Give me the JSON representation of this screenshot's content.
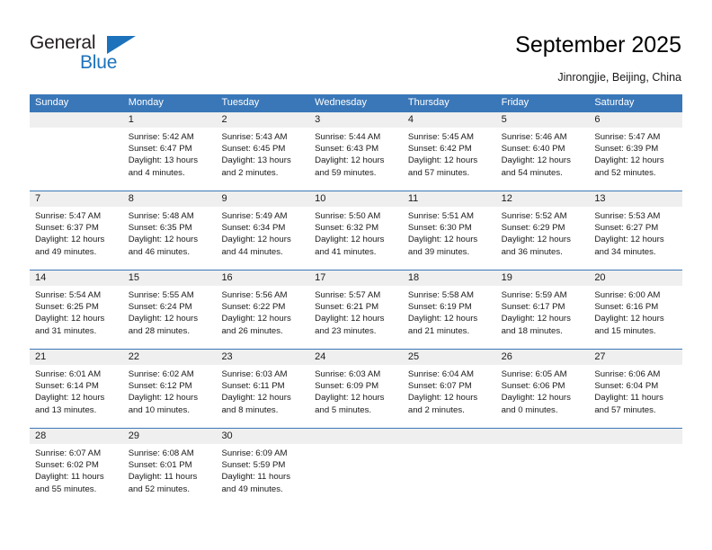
{
  "brand": {
    "name_top": "General",
    "name_bottom": "Blue",
    "triangle_icon": "triangle-icon",
    "accent_color": "#1c72bb"
  },
  "header": {
    "title": "September 2025",
    "location": "Jinrongjie, Beijing, China"
  },
  "theme": {
    "header_blue": "#3a77b8",
    "daynum_gray": "#efefef",
    "text": "#1a1a1a"
  },
  "weekdays": [
    "Sunday",
    "Monday",
    "Tuesday",
    "Wednesday",
    "Thursday",
    "Friday",
    "Saturday"
  ],
  "weeks": [
    {
      "days": [
        {
          "num": "",
          "sunrise": "",
          "sunset": "",
          "daylight_1": "",
          "daylight_2": ""
        },
        {
          "num": "1",
          "sunrise": "Sunrise: 5:42 AM",
          "sunset": "Sunset: 6:47 PM",
          "daylight_1": "Daylight: 13 hours",
          "daylight_2": "and 4 minutes."
        },
        {
          "num": "2",
          "sunrise": "Sunrise: 5:43 AM",
          "sunset": "Sunset: 6:45 PM",
          "daylight_1": "Daylight: 13 hours",
          "daylight_2": "and 2 minutes."
        },
        {
          "num": "3",
          "sunrise": "Sunrise: 5:44 AM",
          "sunset": "Sunset: 6:43 PM",
          "daylight_1": "Daylight: 12 hours",
          "daylight_2": "and 59 minutes."
        },
        {
          "num": "4",
          "sunrise": "Sunrise: 5:45 AM",
          "sunset": "Sunset: 6:42 PM",
          "daylight_1": "Daylight: 12 hours",
          "daylight_2": "and 57 minutes."
        },
        {
          "num": "5",
          "sunrise": "Sunrise: 5:46 AM",
          "sunset": "Sunset: 6:40 PM",
          "daylight_1": "Daylight: 12 hours",
          "daylight_2": "and 54 minutes."
        },
        {
          "num": "6",
          "sunrise": "Sunrise: 5:47 AM",
          "sunset": "Sunset: 6:39 PM",
          "daylight_1": "Daylight: 12 hours",
          "daylight_2": "and 52 minutes."
        }
      ]
    },
    {
      "days": [
        {
          "num": "7",
          "sunrise": "Sunrise: 5:47 AM",
          "sunset": "Sunset: 6:37 PM",
          "daylight_1": "Daylight: 12 hours",
          "daylight_2": "and 49 minutes."
        },
        {
          "num": "8",
          "sunrise": "Sunrise: 5:48 AM",
          "sunset": "Sunset: 6:35 PM",
          "daylight_1": "Daylight: 12 hours",
          "daylight_2": "and 46 minutes."
        },
        {
          "num": "9",
          "sunrise": "Sunrise: 5:49 AM",
          "sunset": "Sunset: 6:34 PM",
          "daylight_1": "Daylight: 12 hours",
          "daylight_2": "and 44 minutes."
        },
        {
          "num": "10",
          "sunrise": "Sunrise: 5:50 AM",
          "sunset": "Sunset: 6:32 PM",
          "daylight_1": "Daylight: 12 hours",
          "daylight_2": "and 41 minutes."
        },
        {
          "num": "11",
          "sunrise": "Sunrise: 5:51 AM",
          "sunset": "Sunset: 6:30 PM",
          "daylight_1": "Daylight: 12 hours",
          "daylight_2": "and 39 minutes."
        },
        {
          "num": "12",
          "sunrise": "Sunrise: 5:52 AM",
          "sunset": "Sunset: 6:29 PM",
          "daylight_1": "Daylight: 12 hours",
          "daylight_2": "and 36 minutes."
        },
        {
          "num": "13",
          "sunrise": "Sunrise: 5:53 AM",
          "sunset": "Sunset: 6:27 PM",
          "daylight_1": "Daylight: 12 hours",
          "daylight_2": "and 34 minutes."
        }
      ]
    },
    {
      "days": [
        {
          "num": "14",
          "sunrise": "Sunrise: 5:54 AM",
          "sunset": "Sunset: 6:25 PM",
          "daylight_1": "Daylight: 12 hours",
          "daylight_2": "and 31 minutes."
        },
        {
          "num": "15",
          "sunrise": "Sunrise: 5:55 AM",
          "sunset": "Sunset: 6:24 PM",
          "daylight_1": "Daylight: 12 hours",
          "daylight_2": "and 28 minutes."
        },
        {
          "num": "16",
          "sunrise": "Sunrise: 5:56 AM",
          "sunset": "Sunset: 6:22 PM",
          "daylight_1": "Daylight: 12 hours",
          "daylight_2": "and 26 minutes."
        },
        {
          "num": "17",
          "sunrise": "Sunrise: 5:57 AM",
          "sunset": "Sunset: 6:21 PM",
          "daylight_1": "Daylight: 12 hours",
          "daylight_2": "and 23 minutes."
        },
        {
          "num": "18",
          "sunrise": "Sunrise: 5:58 AM",
          "sunset": "Sunset: 6:19 PM",
          "daylight_1": "Daylight: 12 hours",
          "daylight_2": "and 21 minutes."
        },
        {
          "num": "19",
          "sunrise": "Sunrise: 5:59 AM",
          "sunset": "Sunset: 6:17 PM",
          "daylight_1": "Daylight: 12 hours",
          "daylight_2": "and 18 minutes."
        },
        {
          "num": "20",
          "sunrise": "Sunrise: 6:00 AM",
          "sunset": "Sunset: 6:16 PM",
          "daylight_1": "Daylight: 12 hours",
          "daylight_2": "and 15 minutes."
        }
      ]
    },
    {
      "days": [
        {
          "num": "21",
          "sunrise": "Sunrise: 6:01 AM",
          "sunset": "Sunset: 6:14 PM",
          "daylight_1": "Daylight: 12 hours",
          "daylight_2": "and 13 minutes."
        },
        {
          "num": "22",
          "sunrise": "Sunrise: 6:02 AM",
          "sunset": "Sunset: 6:12 PM",
          "daylight_1": "Daylight: 12 hours",
          "daylight_2": "and 10 minutes."
        },
        {
          "num": "23",
          "sunrise": "Sunrise: 6:03 AM",
          "sunset": "Sunset: 6:11 PM",
          "daylight_1": "Daylight: 12 hours",
          "daylight_2": "and 8 minutes."
        },
        {
          "num": "24",
          "sunrise": "Sunrise: 6:03 AM",
          "sunset": "Sunset: 6:09 PM",
          "daylight_1": "Daylight: 12 hours",
          "daylight_2": "and 5 minutes."
        },
        {
          "num": "25",
          "sunrise": "Sunrise: 6:04 AM",
          "sunset": "Sunset: 6:07 PM",
          "daylight_1": "Daylight: 12 hours",
          "daylight_2": "and 2 minutes."
        },
        {
          "num": "26",
          "sunrise": "Sunrise: 6:05 AM",
          "sunset": "Sunset: 6:06 PM",
          "daylight_1": "Daylight: 12 hours",
          "daylight_2": "and 0 minutes."
        },
        {
          "num": "27",
          "sunrise": "Sunrise: 6:06 AM",
          "sunset": "Sunset: 6:04 PM",
          "daylight_1": "Daylight: 11 hours",
          "daylight_2": "and 57 minutes."
        }
      ]
    },
    {
      "days": [
        {
          "num": "28",
          "sunrise": "Sunrise: 6:07 AM",
          "sunset": "Sunset: 6:02 PM",
          "daylight_1": "Daylight: 11 hours",
          "daylight_2": "and 55 minutes."
        },
        {
          "num": "29",
          "sunrise": "Sunrise: 6:08 AM",
          "sunset": "Sunset: 6:01 PM",
          "daylight_1": "Daylight: 11 hours",
          "daylight_2": "and 52 minutes."
        },
        {
          "num": "30",
          "sunrise": "Sunrise: 6:09 AM",
          "sunset": "Sunset: 5:59 PM",
          "daylight_1": "Daylight: 11 hours",
          "daylight_2": "and 49 minutes."
        },
        {
          "num": "",
          "sunrise": "",
          "sunset": "",
          "daylight_1": "",
          "daylight_2": ""
        },
        {
          "num": "",
          "sunrise": "",
          "sunset": "",
          "daylight_1": "",
          "daylight_2": ""
        },
        {
          "num": "",
          "sunrise": "",
          "sunset": "",
          "daylight_1": "",
          "daylight_2": ""
        },
        {
          "num": "",
          "sunrise": "",
          "sunset": "",
          "daylight_1": "",
          "daylight_2": ""
        }
      ]
    }
  ]
}
